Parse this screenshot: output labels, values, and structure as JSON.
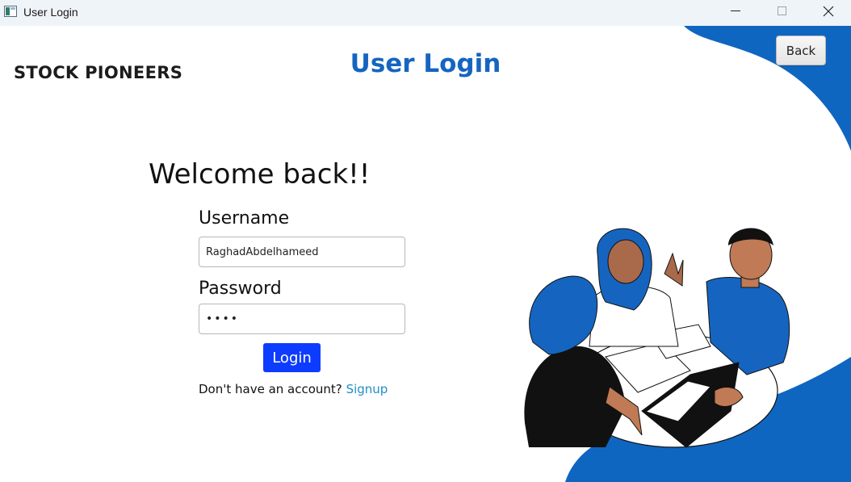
{
  "window": {
    "title": "User Login",
    "controls": [
      "minimize",
      "maximize",
      "close"
    ]
  },
  "header": {
    "brand": "STOCK PIONEERS",
    "title": "User Login",
    "back_label": "Back"
  },
  "form": {
    "welcome": "Welcome back!!",
    "username_label": "Username",
    "username_value": "RaghadAbdelhameed",
    "password_label": "Password",
    "password_masked": "••••",
    "login_label": "Login",
    "signup_prompt": "Don't have an account?",
    "signup_link": "Signup"
  },
  "illustration": {
    "subject": "people-meeting-around-table-with-laptop"
  },
  "colors": {
    "accent_blue": "#0f66c0",
    "title_blue": "#1565c0",
    "login_button": "#0d3cff",
    "link": "#1e8ec9",
    "titlebar_bg": "#eff4f9"
  }
}
